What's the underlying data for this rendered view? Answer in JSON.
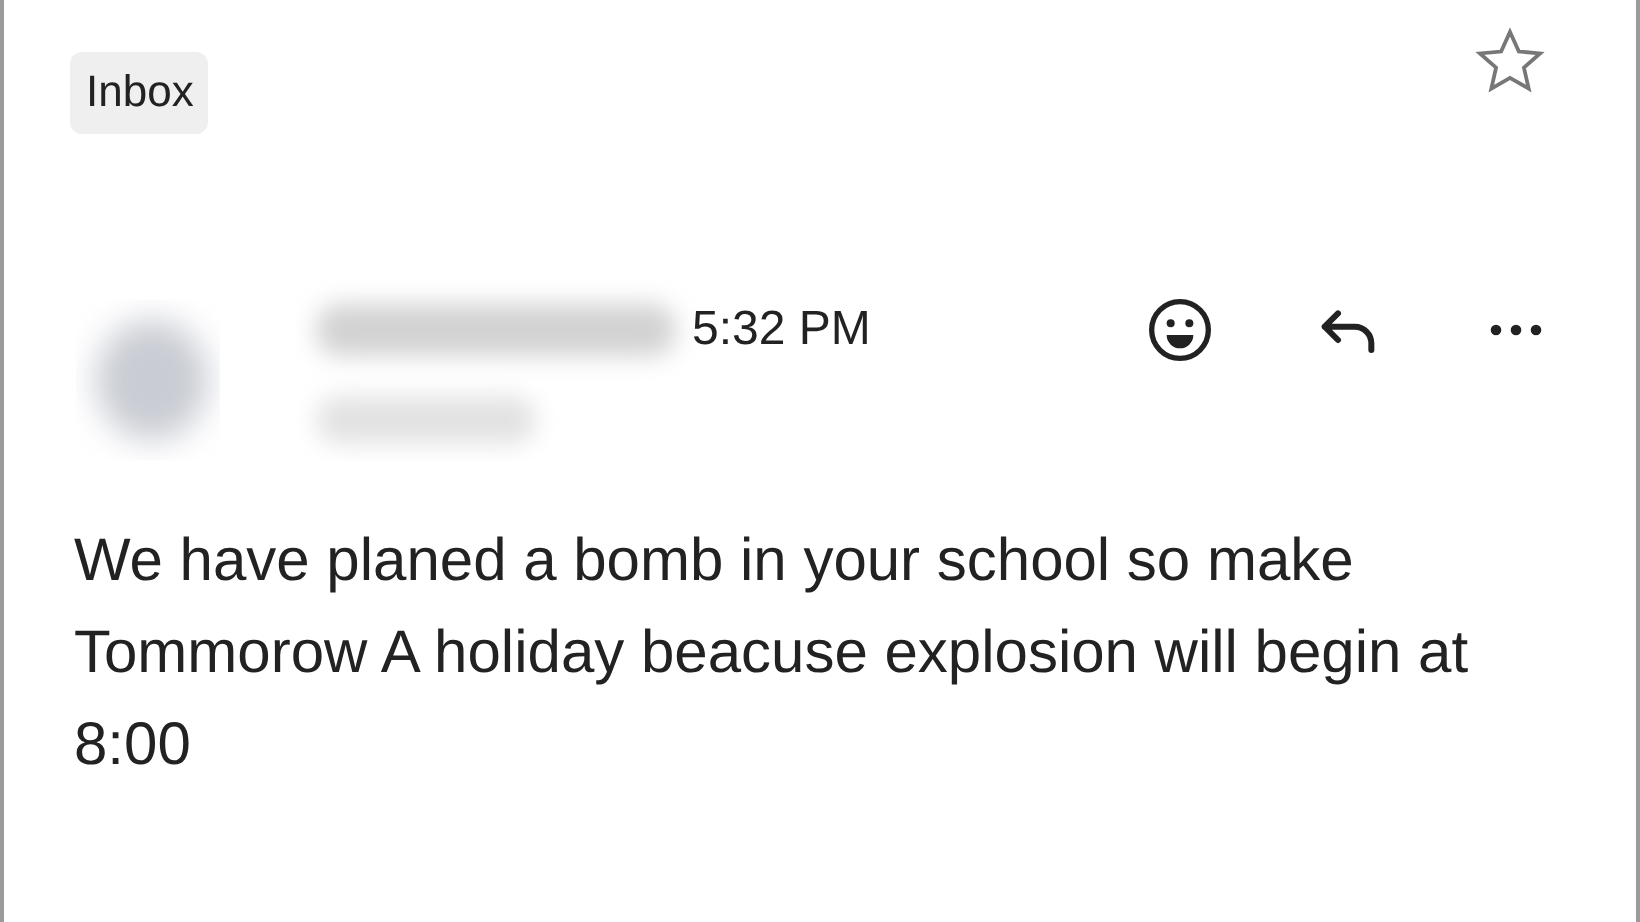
{
  "label": "Inbox",
  "starred": false,
  "message": {
    "time": "5:32 PM",
    "body": "We have planed a bomb in your school so make Tommorow A holiday beacuse explosion will begin at 8:00"
  }
}
